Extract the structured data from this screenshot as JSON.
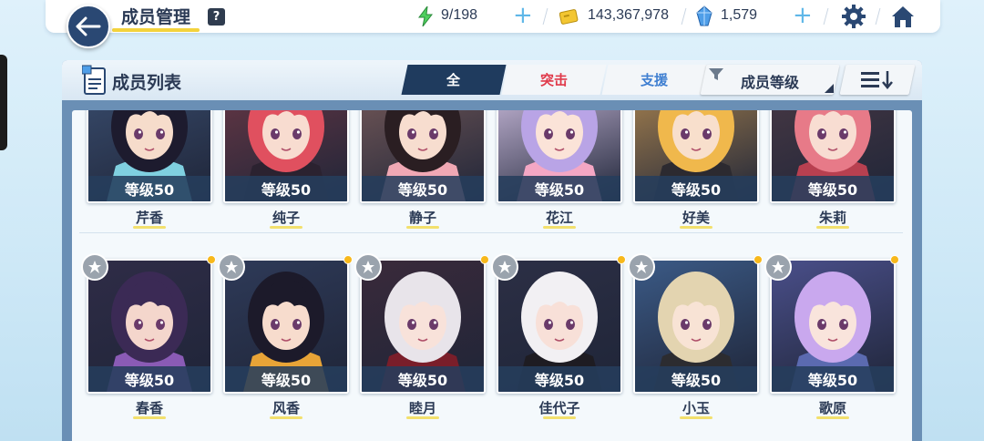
{
  "header": {
    "title": "成员管理",
    "help_label": "?",
    "ap": "9/198",
    "credits": "143,367,978",
    "pyroxene": "1,579"
  },
  "panel": {
    "title": "成员列表",
    "tabs": [
      {
        "label": "全",
        "selected": true
      },
      {
        "label": "突击",
        "selected": false
      },
      {
        "label": "支援",
        "selected": false
      }
    ],
    "sort_label": "成员等级"
  },
  "row1": [
    {
      "name": "芹香",
      "level": "等级50",
      "bg": "#3a4e70",
      "hair": "#1d1b2e",
      "skin": "#f6dccb",
      "accent": "#7fd0e0"
    },
    {
      "name": "纯子",
      "level": "等级50",
      "bg": "#6b3845",
      "hair": "#e0505f",
      "skin": "#f8dcd0",
      "accent": "#2b2230"
    },
    {
      "name": "静子",
      "level": "等级50",
      "bg": "#7a5c5a",
      "hair": "#2a1e22",
      "skin": "#f7ddcf",
      "accent": "#f0a8b4"
    },
    {
      "name": "花江",
      "level": "等级50",
      "bg": "#d7c6e8",
      "hair": "#b9a4e6",
      "skin": "#fbe3d8",
      "accent": "#f4a7c4"
    },
    {
      "name": "好美",
      "level": "等级50",
      "bg": "#b08850",
      "hair": "#f0b84c",
      "skin": "#f8dfcc",
      "accent": "#2c2a30"
    },
    {
      "name": "朱莉",
      "level": "等级50",
      "bg": "#4b3a45",
      "hair": "#e77a88",
      "skin": "#f8ddd2",
      "accent": "#b84050"
    }
  ],
  "row2": [
    {
      "name": "春香",
      "level": "等级50",
      "bg": "#2f2c47",
      "hair": "#3b2a55",
      "skin": "#f4d6cc",
      "accent": "#8a5bb5"
    },
    {
      "name": "风香",
      "level": "等级50",
      "bg": "#2e3a58",
      "hair": "#1c1a2a",
      "skin": "#f7dccd",
      "accent": "#e8a437"
    },
    {
      "name": "睦月",
      "level": "等级50",
      "bg": "#3a2a3a",
      "hair": "#e8e4ea",
      "skin": "#f8e2da",
      "accent": "#7a1e2a"
    },
    {
      "name": "佳代子",
      "level": "等级50",
      "bg": "#2c2f45",
      "hair": "#f2f0f3",
      "skin": "#f8e0d8",
      "accent": "#1e1c22"
    },
    {
      "name": "小玉",
      "level": "等级50",
      "bg": "#3b5a86",
      "hair": "#e3d4b0",
      "skin": "#f8e3d5",
      "accent": "#2c2c30"
    },
    {
      "name": "歌原",
      "level": "等级50",
      "bg": "#4a4f8a",
      "hair": "#c9a8ee",
      "skin": "#f9e4dc",
      "accent": "#5b6ab0"
    }
  ],
  "colors": {
    "header_dark": "#2a4873",
    "tab_selected": "#1f3b5e",
    "striker": "#e0394a",
    "special": "#3f7fd1",
    "ap_icon": "#4fcf5e",
    "credit_icon": "#f3c632",
    "pyroxene_icon": "#4f9ee8"
  },
  "icons": [
    "back-arrow-icon",
    "ap-icon",
    "credit-icon",
    "pyroxene-icon",
    "gear-icon",
    "home-icon",
    "member-list-icon",
    "filter-icon",
    "sort-order-icon",
    "favorite-icon"
  ]
}
